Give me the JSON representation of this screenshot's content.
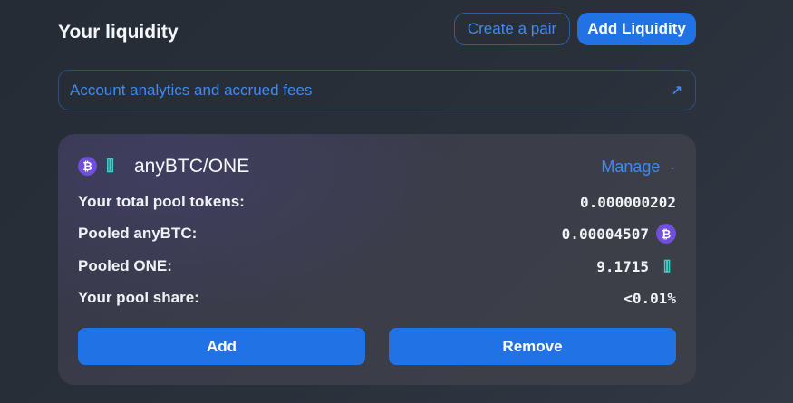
{
  "header": {
    "title": "Your liquidity",
    "create_pair_label": "Create a pair",
    "add_liquidity_label": "Add Liquidity"
  },
  "analytics": {
    "label": "Account analytics and accrued fees",
    "icon": "arrow-up-right-icon"
  },
  "position": {
    "pair_name": "anyBTC/ONE",
    "token0_icon": "bitcoin-icon",
    "token1_icon": "harmony-one-icon",
    "manage_label": "Manage",
    "rows": [
      {
        "label": "Your total pool tokens:",
        "value": "0.000000202"
      },
      {
        "label": "Pooled anyBTC:",
        "value": "0.00004507"
      },
      {
        "label": "Pooled ONE:",
        "value": "9.1715"
      },
      {
        "label": "Your pool share:",
        "value": "<0.01%"
      }
    ],
    "add_label": "Add",
    "remove_label": "Remove"
  },
  "colors": {
    "accent": "#2172e5",
    "link": "#3d8bf0",
    "btc": "#6f4fdc",
    "one": "#39d0c6"
  }
}
